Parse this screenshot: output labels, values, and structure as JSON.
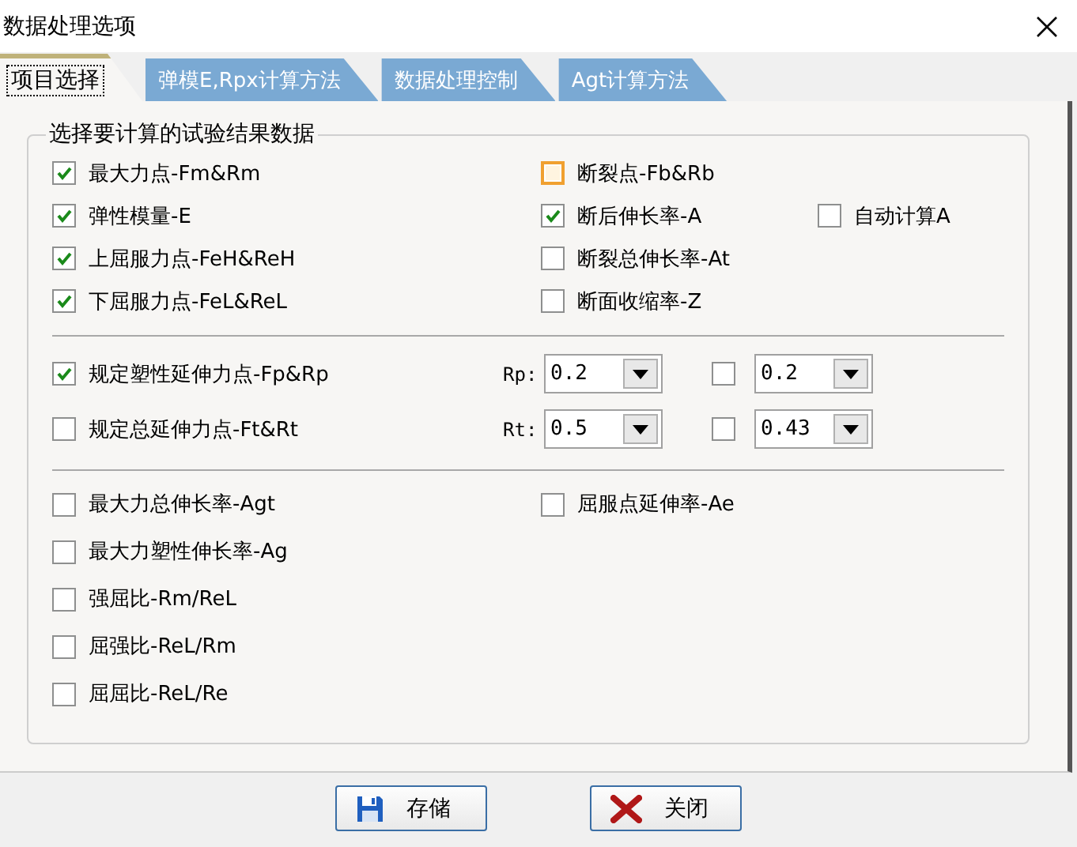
{
  "window": {
    "title": "数据处理选项"
  },
  "tabs": [
    {
      "label": "项目选择",
      "selected": true
    },
    {
      "label": "弹模E,Rpx计算方法",
      "selected": false
    },
    {
      "label": "数据处理控制",
      "selected": false
    },
    {
      "label": "Agt计算方法",
      "selected": false
    }
  ],
  "group": {
    "title": "选择要计算的试验结果数据",
    "results": [
      [
        {
          "label": "最大力点-Fm&Rm",
          "checked": true
        },
        {
          "label": "断裂点-Fb&Rb",
          "checked": false,
          "focused": true
        }
      ],
      [
        {
          "label": "弹性模量-E",
          "checked": true
        },
        {
          "label": "断后伸长率-A",
          "checked": true
        },
        {
          "label": "自动计算A",
          "checked": false
        }
      ],
      [
        {
          "label": "上屈服力点-FeH&ReH",
          "checked": true
        },
        {
          "label": "断裂总伸长率-At",
          "checked": false
        }
      ],
      [
        {
          "label": "下屈服力点-FeL&ReL",
          "checked": true
        },
        {
          "label": "断面收缩率-Z",
          "checked": false
        }
      ]
    ],
    "extensions": [
      {
        "label": "规定塑性延伸力点-Fp&Rp",
        "checked": true,
        "param": "Rp:",
        "value": "0.2",
        "second_checked": false,
        "second_value": "0.2"
      },
      {
        "label": "规定总延伸力点-Ft&Rt",
        "checked": false,
        "param": "Rt:",
        "value": "0.5",
        "second_checked": false,
        "second_value": "0.43"
      }
    ],
    "ratios": [
      [
        {
          "label": "最大力总伸长率-Agt",
          "checked": false
        },
        {
          "label": "屈服点延伸率-Ae",
          "checked": false
        }
      ],
      [
        {
          "label": "最大力塑性伸长率-Ag",
          "checked": false
        }
      ],
      [
        {
          "label": "强屈比-Rm/ReL",
          "checked": false
        }
      ],
      [
        {
          "label": "屈强比-ReL/Rm",
          "checked": false
        }
      ],
      [
        {
          "label": "屈屈比-ReL/Re",
          "checked": false
        }
      ]
    ]
  },
  "buttons": [
    {
      "label": "存储",
      "kind": "save"
    },
    {
      "label": "关闭",
      "kind": "close"
    }
  ]
}
